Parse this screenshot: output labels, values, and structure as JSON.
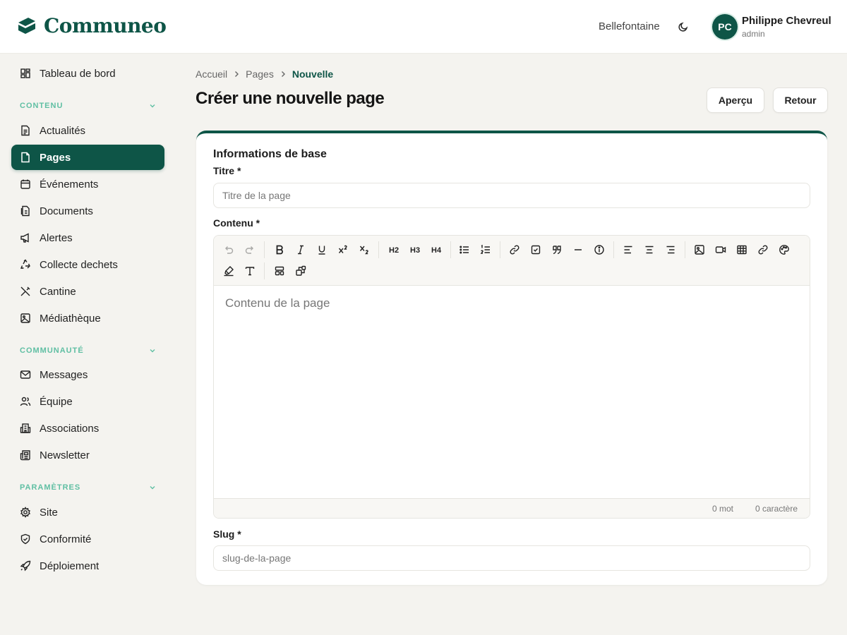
{
  "app": {
    "logo_text": "Communeo",
    "brand_color": "#0e5547",
    "accent_color": "#5fbfa3"
  },
  "header": {
    "site": "Bellefontaine",
    "theme_toggle_icon": "moon-icon",
    "user": {
      "initials": "PC",
      "name": "Philippe Chevreul",
      "role": "admin"
    }
  },
  "sidebar": {
    "dashboard": {
      "label": "Tableau de bord",
      "icon": "dashboard-icon"
    },
    "sections": [
      {
        "title": "CONTENU",
        "items": [
          {
            "label": "Actualités",
            "icon": "news-icon"
          },
          {
            "label": "Pages",
            "icon": "file-icon",
            "active": true
          },
          {
            "label": "Événements",
            "icon": "calendar-icon"
          },
          {
            "label": "Documents",
            "icon": "documents-icon"
          },
          {
            "label": "Alertes",
            "icon": "megaphone-icon"
          },
          {
            "label": "Collecte dechets",
            "icon": "recycle-icon"
          },
          {
            "label": "Cantine",
            "icon": "utensils-icon"
          },
          {
            "label": "Médiathèque",
            "icon": "image-icon"
          }
        ]
      },
      {
        "title": "COMMUNAUTÉ",
        "items": [
          {
            "label": "Messages",
            "icon": "mail-icon"
          },
          {
            "label": "Équipe",
            "icon": "users-icon"
          },
          {
            "label": "Associations",
            "icon": "building-icon"
          },
          {
            "label": "Newsletter",
            "icon": "newspaper-icon"
          }
        ]
      },
      {
        "title": "PARAMÈTRES",
        "items": [
          {
            "label": "Site",
            "icon": "gear-icon"
          },
          {
            "label": "Conformité",
            "icon": "shield-icon"
          },
          {
            "label": "Déploiement",
            "icon": "rocket-icon"
          }
        ]
      }
    ]
  },
  "breadcrumb": {
    "items": [
      "Accueil",
      "Pages"
    ],
    "current": "Nouvelle"
  },
  "page": {
    "title": "Créer une nouvelle page",
    "preview_label": "Aperçu",
    "back_label": "Retour"
  },
  "form": {
    "section_title": "Informations de base",
    "title_label": "Titre *",
    "title_placeholder": "Titre de la page",
    "title_value": "",
    "content_label": "Contenu *",
    "content_placeholder": "Contenu de la page",
    "word_count": "0 mot",
    "char_count": "0 caractère",
    "slug_label": "Slug *",
    "slug_placeholder": "slug-de-la-page",
    "slug_value": ""
  },
  "toolbar": {
    "buttons": [
      "undo-icon",
      "redo-icon",
      "bold-icon",
      "italic-icon",
      "underline-icon",
      "superscript-icon",
      "subscript-icon",
      "heading-2-icon",
      "heading-3-icon",
      "heading-4-icon",
      "bullet-list-icon",
      "ordered-list-icon",
      "link-icon",
      "task-list-icon",
      "quote-icon",
      "horizontal-rule-icon",
      "info-icon",
      "align-left-icon",
      "align-center-icon",
      "align-right-icon",
      "image-icon",
      "video-icon",
      "table-icon",
      "link-icon",
      "palette-icon",
      "highlight-icon",
      "text-icon",
      "layout-icon",
      "blocks-icon"
    ],
    "heading_labels": [
      "H2",
      "H3",
      "H4"
    ]
  }
}
